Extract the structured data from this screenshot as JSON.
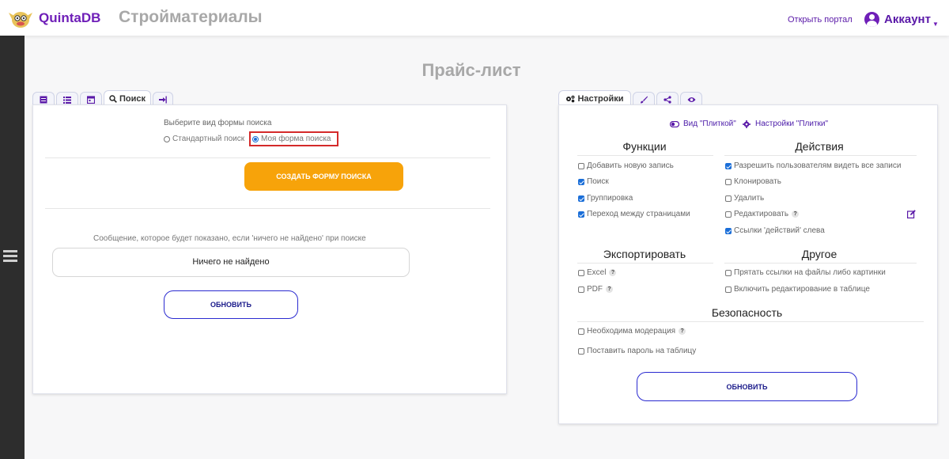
{
  "header": {
    "brand": "QuintaDB",
    "app_title": "Стройматериалы",
    "open_portal": "Открыть портал",
    "account": "Аккаунт"
  },
  "page_title": "Прайс-лист",
  "left_tabs": {
    "search_label": "Поиск"
  },
  "search_form": {
    "choose_label": "Выберите вид формы поиска",
    "option_standard": "Стандартный поиск",
    "option_custom": "Моя форма поиска",
    "selected": "custom",
    "create_button": "создать форму поиска",
    "not_found_label": "Сообщение, которое будет показано, если 'ничего не найдено' при поиске",
    "not_found_value": "Ничего не найдено",
    "update_button": "обновить"
  },
  "right_tabs": {
    "settings_label": "Настройки"
  },
  "settings": {
    "view_tile": "Вид \"Плиткой\"",
    "tile_settings": "Настройки \"Плитки\"",
    "functions": {
      "title": "Функции",
      "items": [
        {
          "label": "Добавить новую запись",
          "checked": false
        },
        {
          "label": "Поиск",
          "checked": true
        },
        {
          "label": "Группировка",
          "checked": true
        },
        {
          "label": "Переход между страницами",
          "checked": true
        }
      ]
    },
    "actions": {
      "title": "Действия",
      "items": [
        {
          "label": "Разрешить пользователям видеть все записи",
          "checked": true
        },
        {
          "label": "Клонировать",
          "checked": false
        },
        {
          "label": "Удалить",
          "checked": false
        },
        {
          "label": "Редактировать",
          "checked": false
        },
        {
          "label": "Ссылки 'действий' слева",
          "checked": true
        }
      ]
    },
    "export": {
      "title": "Экспортировать",
      "items": [
        {
          "label": "Excel",
          "checked": false
        },
        {
          "label": "PDF",
          "checked": false
        }
      ]
    },
    "other": {
      "title": "Другое",
      "items": [
        {
          "label": "Прятать ссылки на файлы либо картинки",
          "checked": false
        },
        {
          "label": "Включить редактирование в таблице",
          "checked": false
        }
      ]
    },
    "security": {
      "title": "Безопасность",
      "items": [
        {
          "label": "Необходима модерация",
          "checked": false
        },
        {
          "label": "Поставить пароль на таблицу",
          "checked": false
        }
      ]
    },
    "update_button": "обновить"
  },
  "help_glyph": "?",
  "colors": {
    "brand_purple": "#6f1fb8",
    "accent_orange": "#f7a30a",
    "checkbox_blue": "#1a6ed8",
    "highlight_red": "#d42a2a"
  }
}
